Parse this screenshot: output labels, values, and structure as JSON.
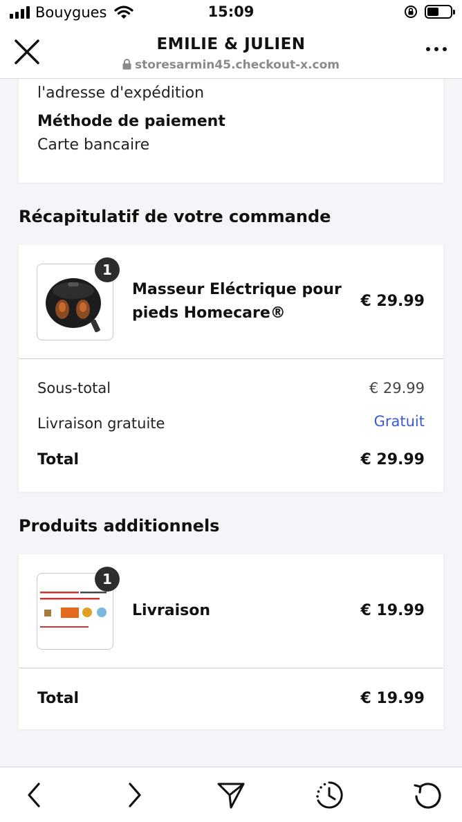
{
  "status_bar": {
    "carrier": "Bouygues",
    "time": "15:09"
  },
  "browser": {
    "title": "EMILIE & JULIEN",
    "url": "storesarmin45.checkout-x.com"
  },
  "shipping": {
    "address_label": "l'adresse d'expédition"
  },
  "payment": {
    "title": "Méthode de paiement",
    "value": "Carte bancaire"
  },
  "order_summary": {
    "heading": "Récapitulatif de votre commande",
    "product": {
      "name_line1": "Masseur Eléctrique pour",
      "name_line2": "pieds Homecare®",
      "quantity": "1",
      "price": "€ 29.99"
    },
    "subtotal_label": "Sous-total",
    "subtotal_value": "€ 29.99",
    "shipping_label": "Livraison gratuite",
    "shipping_value": "Gratuit",
    "total_label": "Total",
    "total_value": "€ 29.99"
  },
  "additional_products": {
    "heading": "Produits additionnels",
    "product": {
      "name": "Livraison",
      "quantity": "1",
      "price": "€ 19.99"
    },
    "total_label": "Total",
    "total_value": "€ 19.99"
  },
  "colors": {
    "link_blue": "#3a5bd0",
    "badge_dark": "#2d2d2d",
    "background": "#f4f5f8"
  },
  "icons": {
    "close": "close-icon",
    "more": "more-icon",
    "back": "chevron-left-icon",
    "forward": "chevron-right-icon",
    "share": "send-icon",
    "history": "history-icon",
    "reload": "reload-icon"
  }
}
